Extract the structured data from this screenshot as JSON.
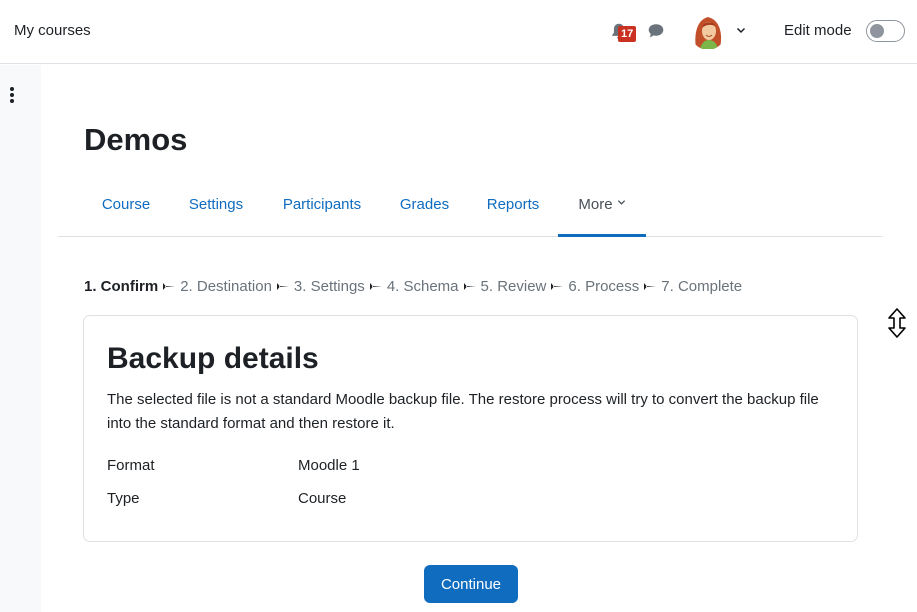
{
  "navbar": {
    "my_courses": "My courses",
    "notification_count": "17",
    "edit_mode_label": "Edit mode"
  },
  "page": {
    "title": "Demos"
  },
  "secondary_nav": {
    "tabs": [
      {
        "label": "Course"
      },
      {
        "label": "Settings"
      },
      {
        "label": "Participants"
      },
      {
        "label": "Grades"
      },
      {
        "label": "Reports"
      },
      {
        "label": "More"
      }
    ]
  },
  "steps": [
    {
      "label": "1. Confirm"
    },
    {
      "label": "2. Destination"
    },
    {
      "label": "3. Settings"
    },
    {
      "label": "4. Schema"
    },
    {
      "label": "5. Review"
    },
    {
      "label": "6. Process"
    },
    {
      "label": "7. Complete"
    }
  ],
  "backup": {
    "title": "Backup details",
    "description": "The selected file is not a standard Moodle backup file. The restore process will try to convert the backup file into the standard format and then restore it.",
    "rows": [
      {
        "label": "Format",
        "value": "Moodle 1"
      },
      {
        "label": "Type",
        "value": "Course"
      }
    ]
  },
  "actions": {
    "continue_label": "Continue"
  },
  "colors": {
    "primary": "#0f6cbf",
    "badge": "#ca3120",
    "drawer_bg": "#f8f9fa"
  },
  "icons": {
    "notifications": "bell-icon",
    "messages": "chat-icon",
    "user_menu": "chevron-down-icon",
    "drawer": "kebab-menu-icon",
    "step_separator": "arrow-right-icon",
    "cursor": "resize-vertical-cursor"
  }
}
